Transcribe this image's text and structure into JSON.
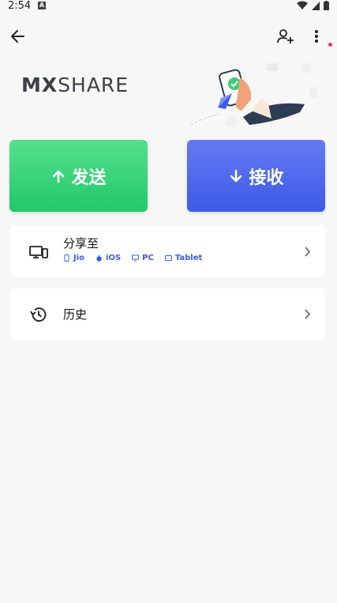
{
  "status_bar": {
    "time": "2:54",
    "a_badge": "A"
  },
  "logo": {
    "mx": "MX",
    "share": "SHARE"
  },
  "buttons": {
    "send_label": "发送",
    "receive_label": "接收"
  },
  "share_card": {
    "title": "分享至",
    "platforms": [
      "Jio",
      "iOS",
      "PC",
      "Tablet"
    ]
  },
  "history_card": {
    "title": "历史"
  },
  "colors": {
    "send": "#22c768",
    "receive": "#3d5be8",
    "platform_text": "#3d5be8",
    "notification_dot": "#f0344a"
  },
  "icons": {
    "back": "arrow-left-icon",
    "add_user": "person-plus-icon",
    "more": "more-vert-icon",
    "share_to": "devices-icon",
    "history": "history-icon",
    "chevron": "chevron-right-icon"
  }
}
